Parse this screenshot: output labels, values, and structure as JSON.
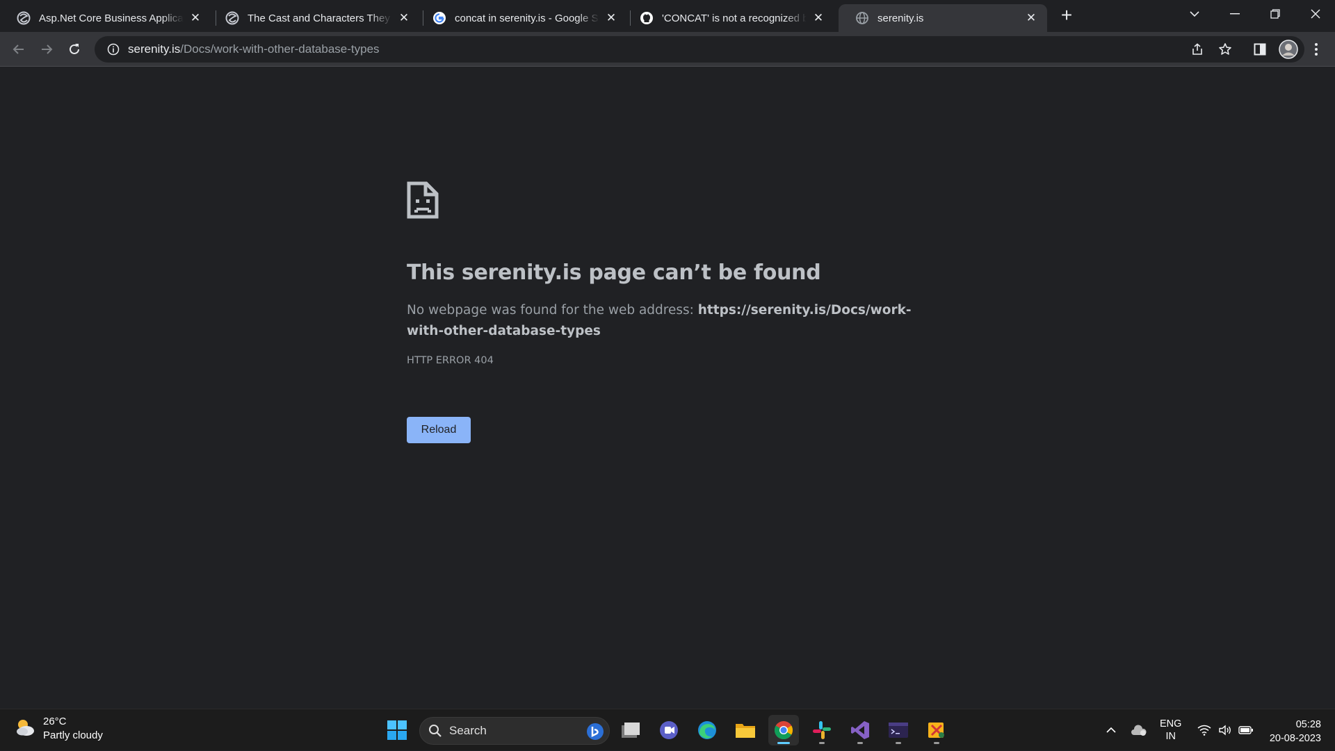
{
  "browser": {
    "tabs": [
      {
        "title": "Asp.Net Core Business Applicatio",
        "icon": "serenity-icon"
      },
      {
        "title": "The Cast and Characters They Pla",
        "icon": "serenity-icon"
      },
      {
        "title": "concat in serenity.is - Google Sea",
        "icon": "google-icon"
      },
      {
        "title": "'CONCAT' is not a recognized bui",
        "icon": "github-icon"
      },
      {
        "title": "serenity.is",
        "icon": "globe-icon",
        "active": true
      }
    ],
    "address": {
      "host": "serenity.is",
      "path": "/Docs/work-with-other-database-types"
    }
  },
  "page": {
    "title": "This serenity.is page can’t be found",
    "desc_prefix": "No webpage was found for the web address: ",
    "desc_url": "https://serenity.is/Docs/work-with-other-database-types",
    "error_code": "HTTP ERROR 404",
    "reload_label": "Reload"
  },
  "taskbar": {
    "weather": {
      "temp": "26°C",
      "condition": "Partly cloudy"
    },
    "search_label": "Search",
    "language": {
      "line1": "ENG",
      "line2": "IN"
    },
    "time": "05:28",
    "date": "20-08-2023"
  },
  "colors": {
    "accent": "#8ab4f8",
    "page_bg": "#202124",
    "taskbar_active": "#60cdff"
  }
}
